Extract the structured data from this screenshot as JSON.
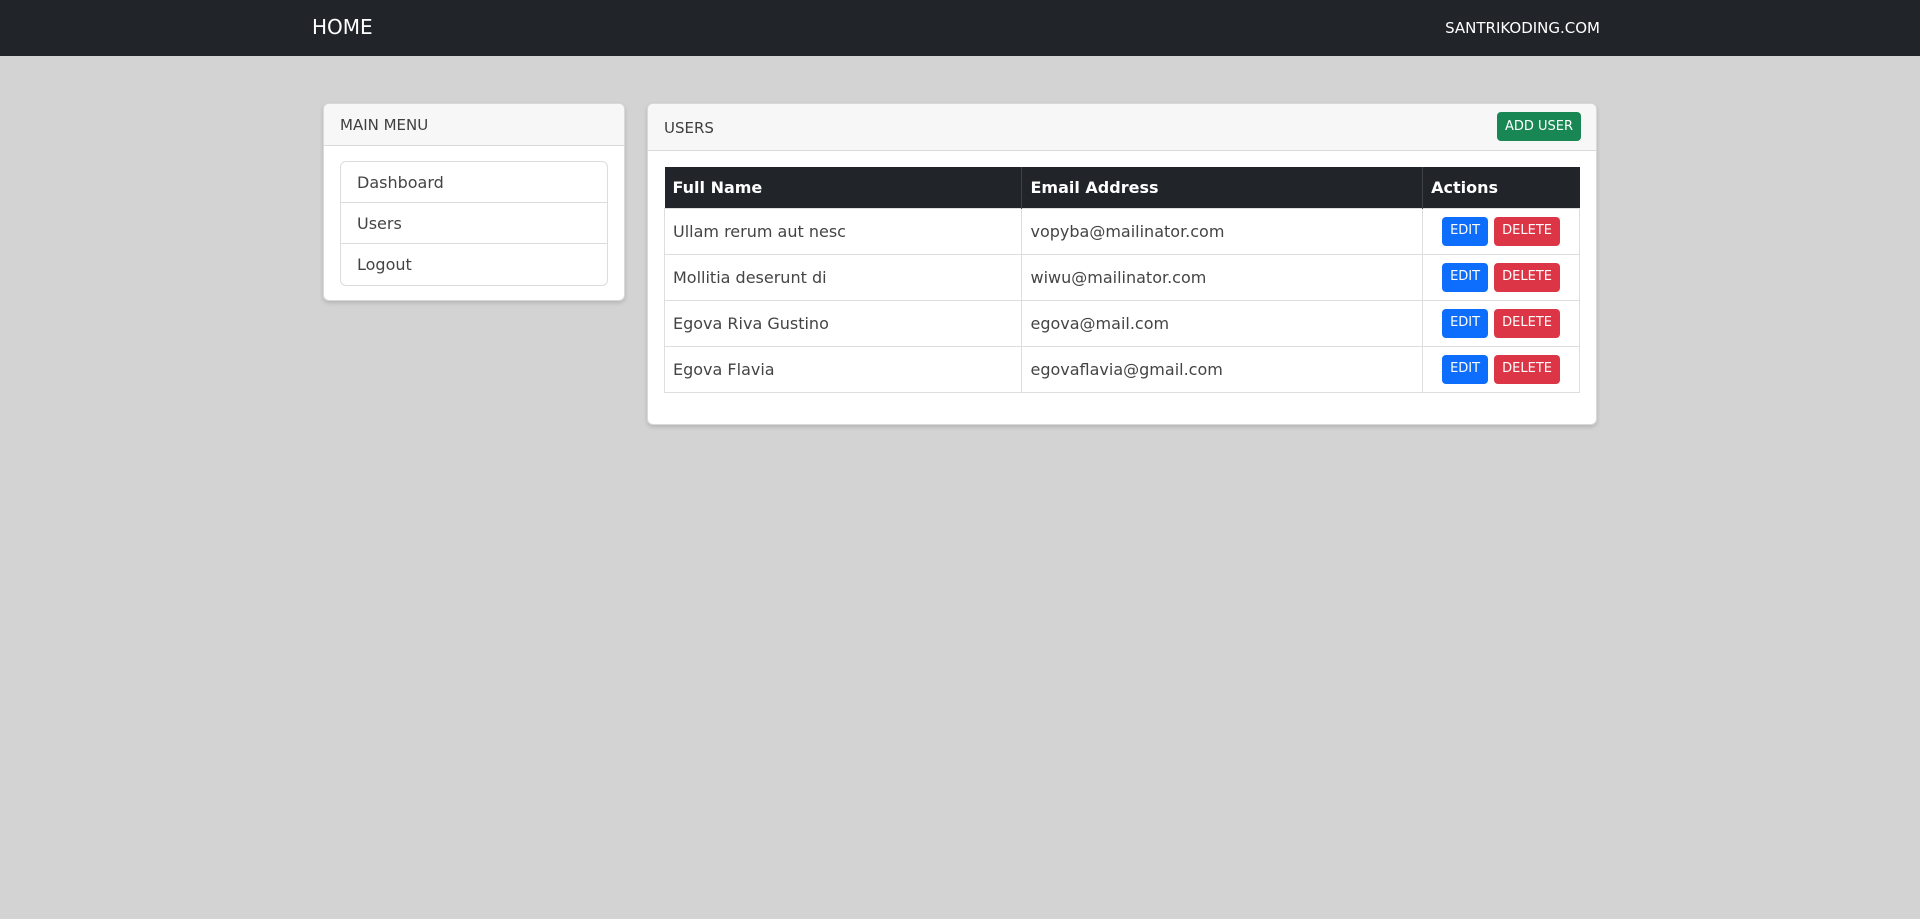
{
  "navbar": {
    "brand": "HOME",
    "right_link": "SANTRIKODING.COM"
  },
  "sidebar": {
    "title": "MAIN MENU",
    "items": [
      {
        "label": "Dashboard"
      },
      {
        "label": "Users"
      },
      {
        "label": "Logout"
      }
    ]
  },
  "users": {
    "title": "USERS",
    "add_button": "ADD USER",
    "columns": [
      "Full Name",
      "Email Address",
      "Actions"
    ],
    "rows": [
      {
        "name": "Ullam rerum aut nesc",
        "email": "vopyba@mailinator.com"
      },
      {
        "name": "Mollitia deserunt di",
        "email": "wiwu@mailinator.com"
      },
      {
        "name": "Egova Riva Gustino",
        "email": "egova@mail.com"
      },
      {
        "name": "Egova Flavia",
        "email": "egovaflavia@gmail.com"
      }
    ],
    "edit_label": "EDIT",
    "delete_label": "DELETE"
  },
  "colors": {
    "navbar": "#212529",
    "background": "#d3d3d3",
    "success": "#198754",
    "primary": "#0d6efd",
    "danger": "#dc3545"
  }
}
